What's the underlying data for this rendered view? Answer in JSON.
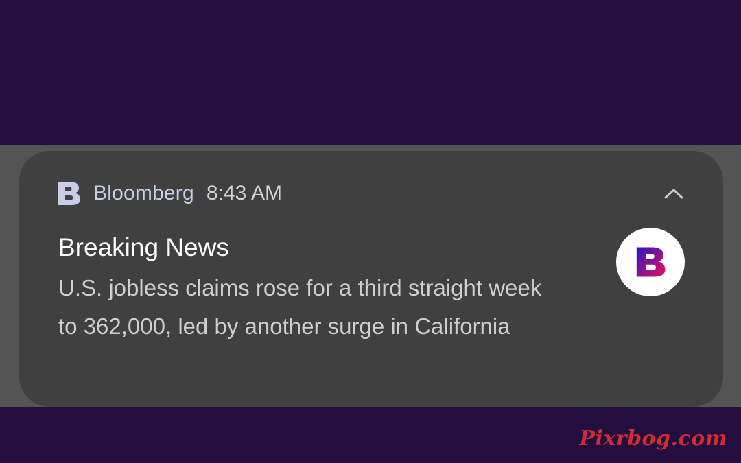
{
  "notification": {
    "app_name": "Bloomberg",
    "time": "8:43 AM",
    "title": "Breaking News",
    "body": "U.S. jobless claims rose for a third straight week to 362,000, led by another surge in California",
    "app_icon": "bloomberg-b-icon",
    "avatar_icon": "bloomberg-b-logo",
    "expand_icon": "chevron-up-icon"
  },
  "watermark": "Pixrbog.com",
  "colors": {
    "background": "#220f40",
    "card": "#404040",
    "app_name": "#c8cde8",
    "avatar_gradient_start": "#2d16c8",
    "avatar_gradient_end": "#e2125e",
    "watermark": "#d42a30"
  }
}
